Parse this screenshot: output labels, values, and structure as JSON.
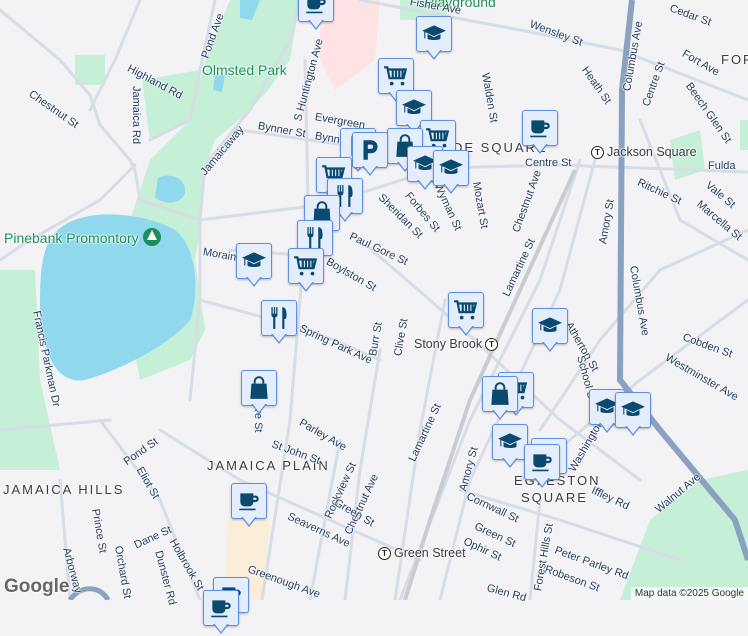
{
  "map": {
    "colors": {
      "land": "#f3f2f5",
      "park": "#c5efd6",
      "water": "#8fd8ee",
      "road": "#d6dde6",
      "highway": "#8aa1bf",
      "marker_bg": "#e4edfc",
      "marker_border": "#5d8fe0",
      "icon": "#0b4a6f"
    },
    "labels": [
      "Highland Rd",
      "Jamaica Rd",
      "Chestnut St",
      "Pond Ave",
      "Olmsted Park",
      "S Huntington Ave",
      "Evergreen",
      "Bynner St",
      "Bynner",
      "Jamaicaway",
      "Pinebank Promontory",
      "Morain",
      "Paul Gore St",
      "Boylston St",
      "Spring Park Ave",
      "Burr St",
      "Clive St",
      "Sheridan St",
      "Forbes St",
      "Wyman St",
      "Mozart St",
      "Walden St",
      "Chestnut Ave",
      "Lamartine St",
      "Centre St",
      "Ritchie St",
      "Heath St",
      "Wensley St",
      "Cedar St",
      "Columbus Ave",
      "Columbus Ave",
      "Centre St",
      "Fort Ave",
      "Beech Glen St",
      "FOR",
      "Fulda",
      "Vale St",
      "Marcella St",
      "Amory St",
      "DE SQUARE",
      "Atherton St",
      "Cobden St",
      "Westminster Ave",
      "Lamartine St",
      "Amory St",
      "Cornwall St",
      "Washington",
      "EGLESTON",
      "SQUARE",
      "Iffley Rd",
      "Walnut Ave",
      "Ophir St",
      "Peter Parley Rd",
      "Robeson St",
      "Forest Hills St",
      "Glen Rd",
      "Francis Parkman Dr",
      "Pond St",
      "Eliot St",
      "JAMAICA HILLS",
      "JAMAICA PLAIN",
      "Parley Ave",
      "St John St",
      "Rockview St",
      "Chestnut Ave",
      "Green St",
      "Seaverns Ave",
      "Prince St",
      "Orchard St",
      "Dane St",
      "Holbrook St",
      "Dunster Rd",
      "Arborway",
      "Greenough Ave",
      "Centre St",
      "Playground",
      "Fisher Ave",
      "School St",
      "Green St"
    ],
    "stations": [
      "Jackson Square",
      "Stony Brook",
      "Green Street"
    ],
    "markers": [
      "coffee-icon",
      "school-icon",
      "cart-icon",
      "school-icon",
      "cart-icon",
      "bag-icon",
      "school-icon",
      "school-icon",
      "coffee-icon",
      "parking-icon",
      "parking-icon",
      "cart-icon",
      "restaurant-icon",
      "bag-icon",
      "restaurant-icon",
      "cart-icon",
      "school-icon",
      "restaurant-icon",
      "bag-icon",
      "cart-icon",
      "school-icon",
      "cart-icon",
      "bag-icon",
      "school-icon",
      "coffee-icon",
      "coffee-icon",
      "school-icon",
      "school-icon",
      "coffee-icon",
      "coffee-icon",
      "coffee-icon"
    ],
    "attribution": "Map data ©2025 Google",
    "logo": "Google"
  }
}
